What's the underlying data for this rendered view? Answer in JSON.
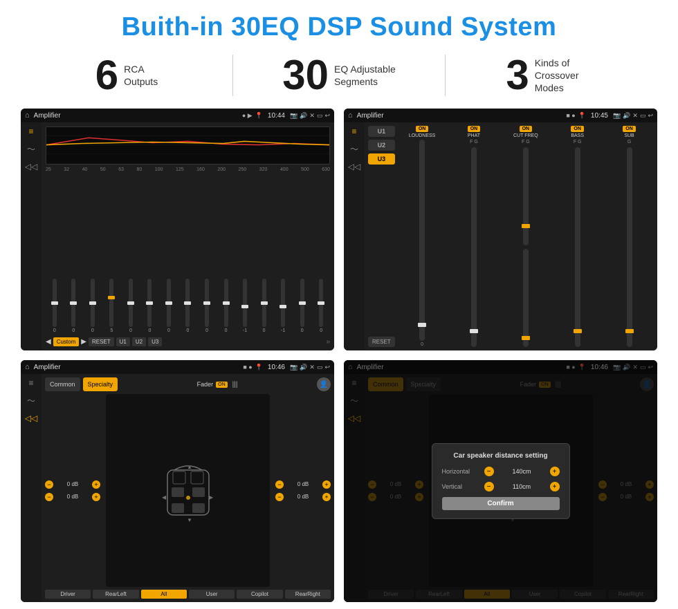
{
  "title": "Buith-in 30EQ DSP Sound System",
  "stats": [
    {
      "number": "6",
      "label_line1": "RCA",
      "label_line2": "Outputs"
    },
    {
      "number": "30",
      "label_line1": "EQ Adjustable",
      "label_line2": "Segments"
    },
    {
      "number": "3",
      "label_line1": "Kinds of",
      "label_line2": "Crossover Modes"
    }
  ],
  "screens": [
    {
      "id": "eq-screen",
      "app_name": "Amplifier",
      "time": "10:44",
      "type": "eq",
      "eq_bands": [
        "25",
        "32",
        "40",
        "50",
        "63",
        "80",
        "100",
        "125",
        "160",
        "200",
        "250",
        "320",
        "400",
        "500",
        "630"
      ],
      "eq_values": [
        "0",
        "0",
        "0",
        "5",
        "0",
        "0",
        "0",
        "0",
        "0",
        "0",
        "-1",
        "0",
        "-1"
      ],
      "preset": "Custom",
      "buttons": [
        "Custom",
        "RESET",
        "U1",
        "U2",
        "U3"
      ]
    },
    {
      "id": "crossover-screen",
      "app_name": "Amplifier",
      "time": "10:45",
      "type": "crossover",
      "presets": [
        "U1",
        "U2",
        "U3"
      ],
      "active_preset": "U3",
      "channels": [
        {
          "label": "LOUDNESS",
          "on": true
        },
        {
          "label": "PHAT",
          "on": true
        },
        {
          "label": "CUT FREQ",
          "on": true
        },
        {
          "label": "BASS",
          "on": true
        },
        {
          "label": "SUB",
          "on": true
        }
      ]
    },
    {
      "id": "speaker-screen",
      "app_name": "Amplifier",
      "time": "10:46",
      "type": "speaker",
      "tabs": [
        "Common",
        "Specialty"
      ],
      "active_tab": "Specialty",
      "fader_label": "Fader",
      "fader_on": true,
      "left_controls": [
        {
          "value": "0 dB"
        },
        {
          "value": "0 dB"
        }
      ],
      "right_controls": [
        {
          "value": "0 dB"
        },
        {
          "value": "0 dB"
        }
      ],
      "positions": [
        "Driver",
        "RearLeft",
        "All",
        "User",
        "Copilot",
        "RearRight"
      ]
    },
    {
      "id": "dialog-screen",
      "app_name": "Amplifier",
      "time": "10:46",
      "type": "dialog",
      "tabs": [
        "Common",
        "Specialty"
      ],
      "active_tab": "Common",
      "dialog": {
        "title": "Car speaker distance setting",
        "horizontal_label": "Horizontal",
        "horizontal_value": "140cm",
        "vertical_label": "Vertical",
        "vertical_value": "110cm",
        "confirm_label": "Confirm"
      },
      "left_controls": [
        {
          "value": "0 dB"
        },
        {
          "value": "0 dB"
        }
      ],
      "right_controls": [
        {
          "value": "0 dB"
        },
        {
          "value": "0 dB"
        }
      ],
      "positions": [
        "Driver",
        "RearLeft",
        "All",
        "User",
        "Copilot",
        "RearRight"
      ]
    }
  ]
}
